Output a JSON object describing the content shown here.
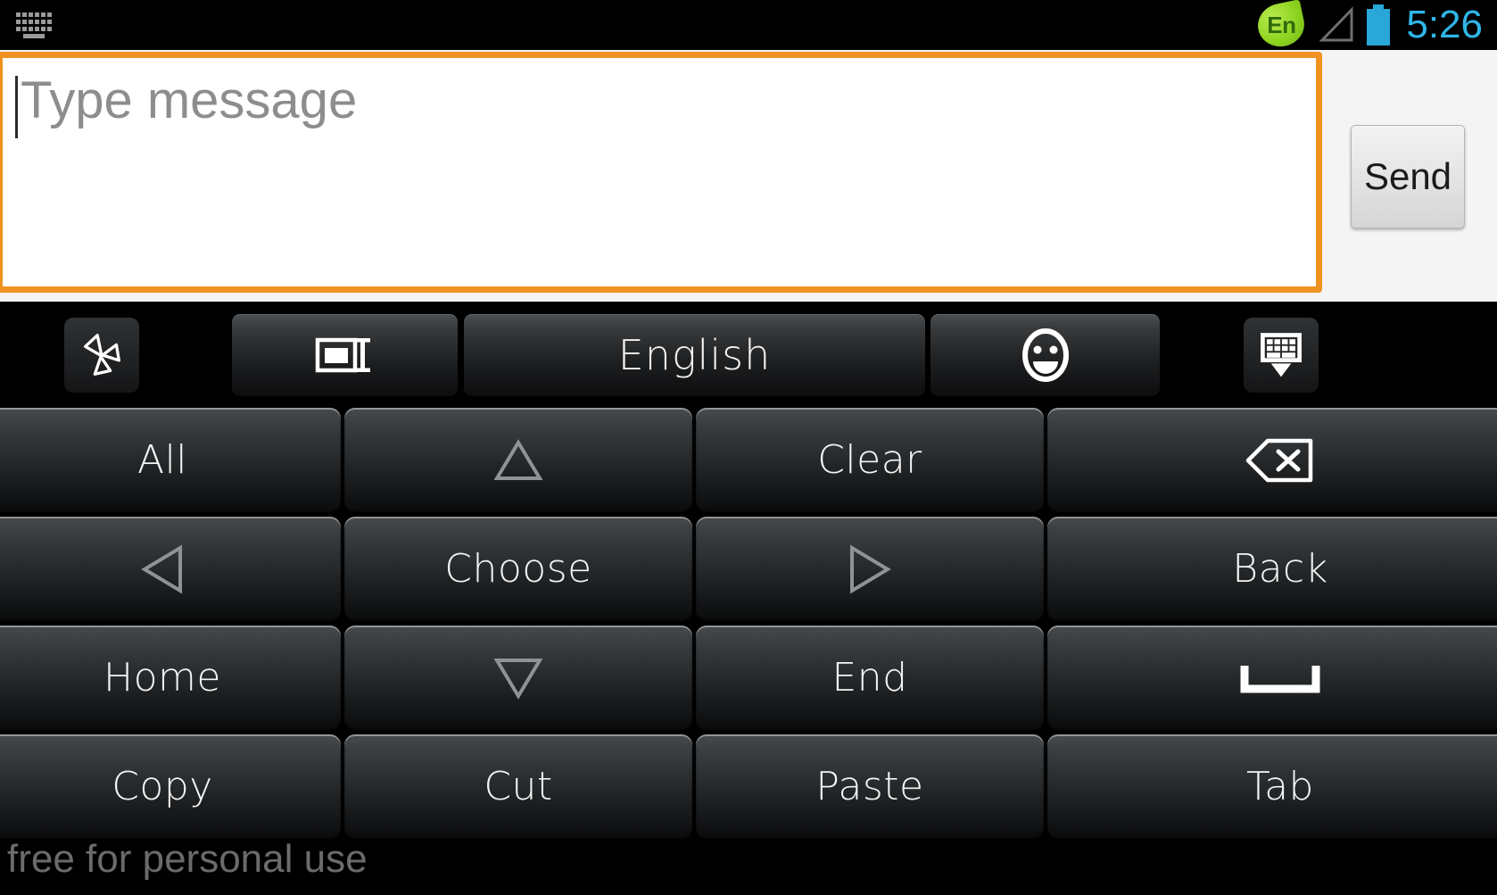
{
  "status_bar": {
    "keyboard_icon": "keyboard-icon",
    "ime_badge": "En",
    "signal_icon": "signal-triangle-icon",
    "battery_icon": "battery-full-icon",
    "clock": "5:26",
    "colors": {
      "clock": "#2fb6e8",
      "battery": "#28a7d8",
      "ime_leaf": "#8fd421"
    }
  },
  "compose": {
    "input_placeholder": "Type message",
    "input_value": "",
    "send_label": "Send",
    "focus_border_color": "#f0921f"
  },
  "keyboard": {
    "toolbar": [
      {
        "name": "ime-logo-button",
        "icon": "pinwheel-logo-icon",
        "label": ""
      },
      {
        "name": "input-method-button",
        "icon": "text-field-cursor-icon",
        "label": ""
      },
      {
        "name": "language-button",
        "icon": "",
        "label": "English"
      },
      {
        "name": "emoji-button",
        "icon": "smiley-face-icon",
        "label": ""
      },
      {
        "name": "hide-keyboard-button",
        "icon": "keyboard-hide-icon",
        "label": ""
      }
    ],
    "rows": [
      [
        {
          "name": "key-all",
          "label": "All",
          "icon": ""
        },
        {
          "name": "key-up",
          "label": "",
          "icon": "arrow-up-icon"
        },
        {
          "name": "key-clear",
          "label": "Clear",
          "icon": ""
        },
        {
          "name": "key-backspace",
          "label": "",
          "icon": "backspace-icon"
        }
      ],
      [
        {
          "name": "key-left",
          "label": "",
          "icon": "arrow-left-icon"
        },
        {
          "name": "key-choose",
          "label": "Choose",
          "icon": ""
        },
        {
          "name": "key-right",
          "label": "",
          "icon": "arrow-right-icon"
        },
        {
          "name": "key-back",
          "label": "Back",
          "icon": ""
        }
      ],
      [
        {
          "name": "key-home",
          "label": "Home",
          "icon": ""
        },
        {
          "name": "key-down",
          "label": "",
          "icon": "arrow-down-icon"
        },
        {
          "name": "key-end",
          "label": "End",
          "icon": ""
        },
        {
          "name": "key-space",
          "label": "",
          "icon": "space-bar-icon"
        }
      ],
      [
        {
          "name": "key-copy",
          "label": "Copy",
          "icon": ""
        },
        {
          "name": "key-cut",
          "label": "Cut",
          "icon": ""
        },
        {
          "name": "key-paste",
          "label": "Paste",
          "icon": ""
        },
        {
          "name": "key-tab",
          "label": "Tab",
          "icon": ""
        }
      ]
    ]
  },
  "watermark": "free for personal use"
}
